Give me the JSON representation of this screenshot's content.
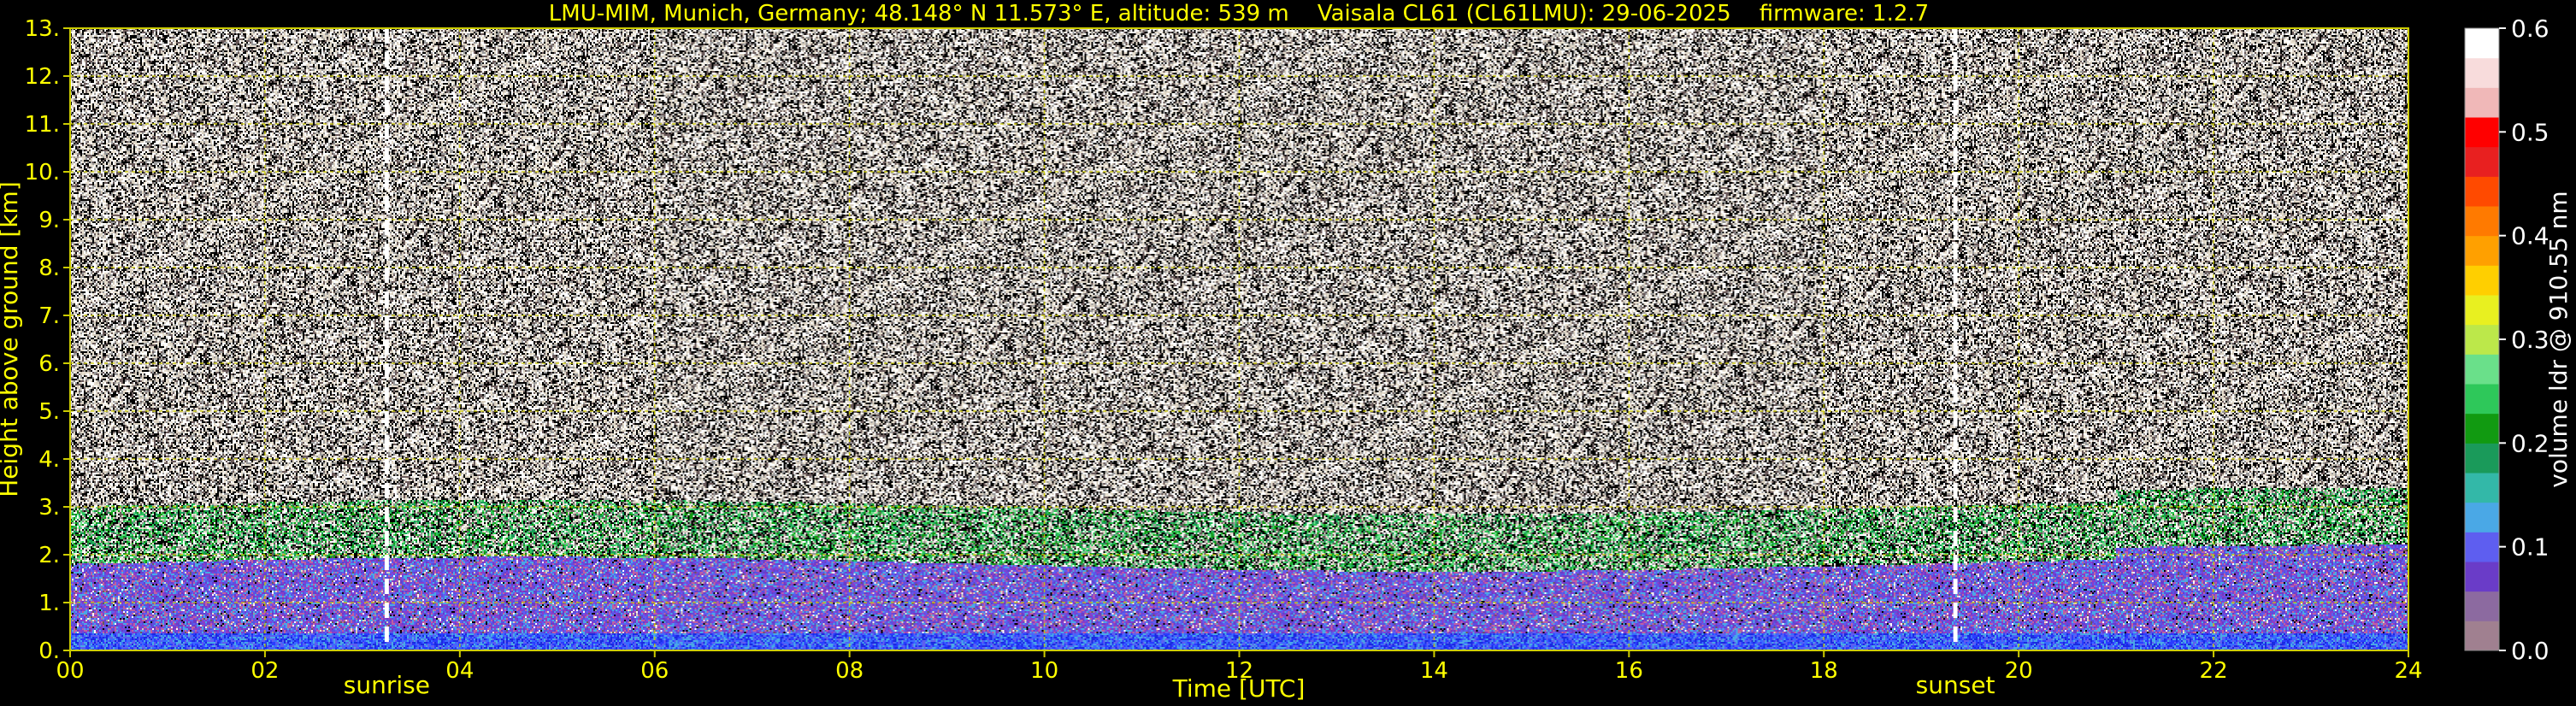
{
  "chart_data": {
    "type": "heatmap",
    "title": "LMU-MIM, Munich, Germany; 48.148° N 11.573° E, altitude: 539 m    Vaisala CL61 (CL61LMU): 29-06-2025    firmware: 1.2.7",
    "xlabel": "Time [UTC]",
    "ylabel": "Height above ground [km]",
    "colorbar_label": "volume ldr @ 910.55 nm",
    "xlim": [
      0,
      24
    ],
    "ylim": [
      0,
      13
    ],
    "clim": [
      0,
      0.6
    ],
    "grid": true,
    "x_ticks": [
      0,
      2,
      4,
      6,
      8,
      10,
      12,
      14,
      16,
      18,
      20,
      22,
      24
    ],
    "x_tick_labels": [
      "00",
      "02",
      "04",
      "06",
      "08",
      "10",
      "12",
      "14",
      "16",
      "18",
      "20",
      "22",
      "24"
    ],
    "y_ticks": [
      0,
      1,
      2,
      3,
      4,
      5,
      6,
      7,
      8,
      9,
      10,
      11,
      12,
      13
    ],
    "y_tick_labels": [
      "0.",
      "1.",
      "2.",
      "3.",
      "4.",
      "5.",
      "6.",
      "7.",
      "8.",
      "9.",
      "10.",
      "11.",
      "12.",
      "13."
    ],
    "colorbar_ticks": [
      0.0,
      0.1,
      0.2,
      0.3,
      0.4,
      0.5,
      0.6
    ],
    "colorbar_tick_labels": [
      "0.0",
      "0.1",
      "0.2",
      "0.3",
      "0.4",
      "0.5",
      "0.6"
    ],
    "colormap": [
      "#a08090",
      "#8c6aa0",
      "#6a3cc8",
      "#5e5ef0",
      "#4aa8e6",
      "#33b8a8",
      "#1a9a5a",
      "#119a11",
      "#2ec85a",
      "#6ae08a",
      "#bce84a",
      "#e8f020",
      "#ffcf00",
      "#ffa000",
      "#ff7a00",
      "#ff4a00",
      "#e82020",
      "#ff0000",
      "#f0b8b8",
      "#f8dcdc",
      "#ffffff"
    ],
    "annotations": [
      {
        "label": "sunrise",
        "x": 3.25
      },
      {
        "label": "sunset",
        "x": 19.35
      }
    ],
    "boundary_layer_top_km": 1.8,
    "colors": {
      "text": "#ffff00",
      "grid": "#cccc00",
      "background": "#000000",
      "event_line": "#ffffff"
    }
  }
}
